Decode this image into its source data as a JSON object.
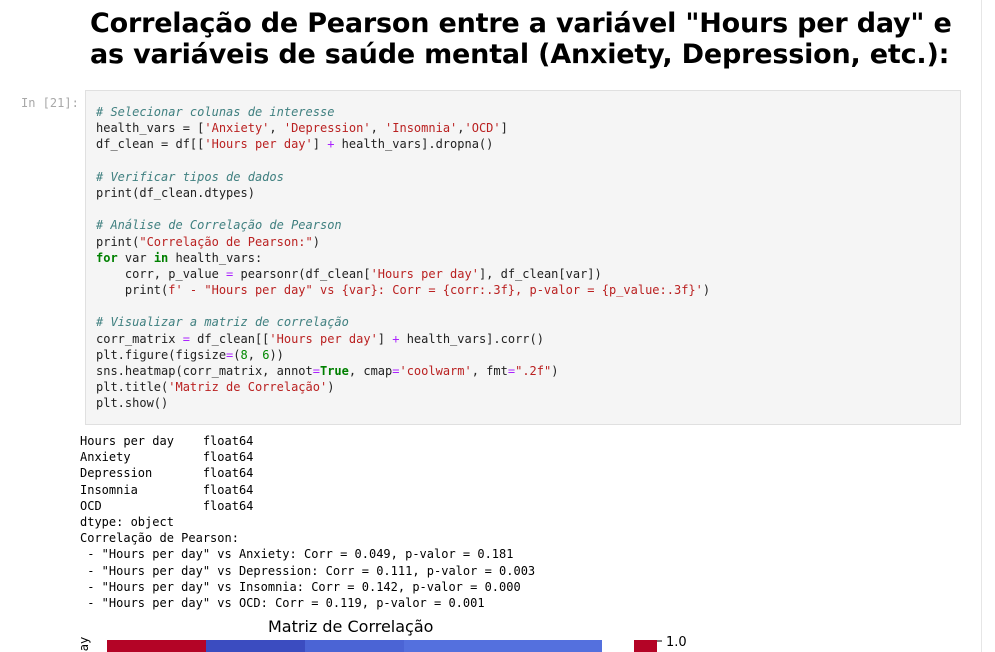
{
  "heading": "Correlação de Pearson entre a variável \"Hours per day\" e as variáveis de saúde mental (Anxiety, Depression, etc.):",
  "cell": {
    "prompt": "In [21]:",
    "code_lines": [
      [
        {
          "t": "# Selecionar colunas de interesse",
          "c": "comment"
        }
      ],
      [
        {
          "t": "health_vars = ["
        },
        {
          "t": "'Anxiety'",
          "c": "string"
        },
        {
          "t": ", "
        },
        {
          "t": "'Depression'",
          "c": "string"
        },
        {
          "t": ", "
        },
        {
          "t": "'Insomnia'",
          "c": "string"
        },
        {
          "t": ","
        },
        {
          "t": "'OCD'",
          "c": "string"
        },
        {
          "t": "]"
        }
      ],
      [
        {
          "t": "df_clean = df[["
        },
        {
          "t": "'Hours per day'",
          "c": "string"
        },
        {
          "t": "] "
        },
        {
          "t": "+",
          "c": "op"
        },
        {
          "t": " health_vars].dropna()"
        }
      ],
      [
        {
          "t": ""
        }
      ],
      [
        {
          "t": "# Verificar tipos de dados",
          "c": "comment"
        }
      ],
      [
        {
          "t": "print(df_clean.dtypes)"
        }
      ],
      [
        {
          "t": ""
        }
      ],
      [
        {
          "t": "# Análise de Correlação de Pearson",
          "c": "comment"
        }
      ],
      [
        {
          "t": "print("
        },
        {
          "t": "\"Correlação de Pearson:\"",
          "c": "string"
        },
        {
          "t": ")"
        }
      ],
      [
        {
          "t": "for",
          "c": "kw"
        },
        {
          "t": " var "
        },
        {
          "t": "in",
          "c": "kw"
        },
        {
          "t": " health_vars:"
        }
      ],
      [
        {
          "t": "    corr, p_value "
        },
        {
          "t": "=",
          "c": "op"
        },
        {
          "t": " pearsonr(df_clean["
        },
        {
          "t": "'Hours per day'",
          "c": "string"
        },
        {
          "t": "], df_clean[var])"
        }
      ],
      [
        {
          "t": "    print("
        },
        {
          "t": "f' - \"Hours per day\" vs {var}: Corr = {corr:.3f}, p-valor = {p_value:.3f}'",
          "c": "string"
        },
        {
          "t": ")"
        }
      ],
      [
        {
          "t": ""
        }
      ],
      [
        {
          "t": "# Visualizar a matriz de correlação",
          "c": "comment"
        }
      ],
      [
        {
          "t": "corr_matrix "
        },
        {
          "t": "=",
          "c": "op"
        },
        {
          "t": " df_clean[["
        },
        {
          "t": "'Hours per day'",
          "c": "string"
        },
        {
          "t": "] "
        },
        {
          "t": "+",
          "c": "op"
        },
        {
          "t": " health_vars].corr()"
        }
      ],
      [
        {
          "t": "plt.figure(figsize"
        },
        {
          "t": "=",
          "c": "op"
        },
        {
          "t": "("
        },
        {
          "t": "8",
          "c": "num"
        },
        {
          "t": ", "
        },
        {
          "t": "6",
          "c": "num"
        },
        {
          "t": "))"
        }
      ],
      [
        {
          "t": "sns.heatmap(corr_matrix, annot"
        },
        {
          "t": "=",
          "c": "op"
        },
        {
          "t": "True",
          "c": "kw"
        },
        {
          "t": ", cmap"
        },
        {
          "t": "=",
          "c": "op"
        },
        {
          "t": "'coolwarm'",
          "c": "string"
        },
        {
          "t": ", fmt"
        },
        {
          "t": "=",
          "c": "op"
        },
        {
          "t": "\".2f\"",
          "c": "string"
        },
        {
          "t": ")"
        }
      ],
      [
        {
          "t": "plt.title("
        },
        {
          "t": "'Matriz de Correlação'",
          "c": "string"
        },
        {
          "t": ")"
        }
      ],
      [
        {
          "t": "plt.show()"
        }
      ]
    ]
  },
  "output_lines": [
    "Hours per day    float64",
    "Anxiety          float64",
    "Depression       float64",
    "Insomnia         float64",
    "OCD              float64",
    "dtype: object",
    "Correlação de Pearson:",
    " - \"Hours per day\" vs Anxiety: Corr = 0.049, p-valor = 0.181",
    " - \"Hours per day\" vs Depression: Corr = 0.111, p-valor = 0.003",
    " - \"Hours per day\" vs Insomnia: Corr = 0.142, p-valor = 0.000",
    " - \"Hours per day\" vs OCD: Corr = 0.119, p-valor = 0.001"
  ],
  "chart_data": {
    "type": "heatmap",
    "title": "Matriz de Correlação",
    "y_tick_partial": "ay",
    "visible_row_colors": [
      "#b40426",
      "#3b4cc0",
      "#4b64d5",
      "#5470de",
      "#5470de"
    ],
    "colorbar_tick": "1.0",
    "colorbar_top_color": "#b40426"
  }
}
